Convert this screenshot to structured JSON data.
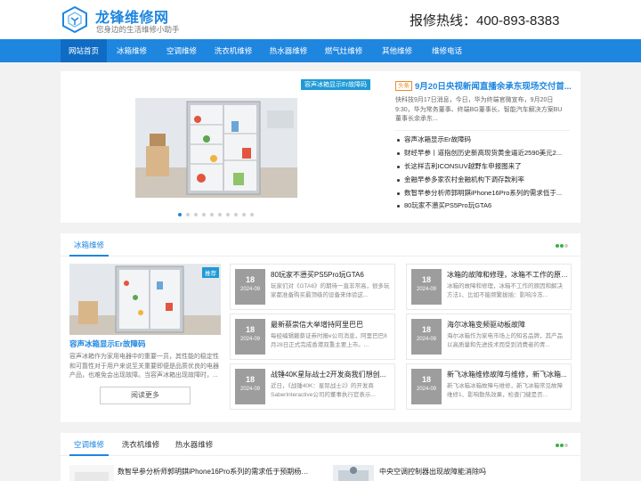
{
  "header": {
    "site_name": "龙锋维修网",
    "tagline": "您身边的生活维修小助手",
    "hotline": "报修热线：400-893-8383"
  },
  "nav": {
    "items": [
      {
        "label": "网站首页",
        "active": true
      },
      {
        "label": "冰箱维修"
      },
      {
        "label": "空调维修"
      },
      {
        "label": "洗衣机维修"
      },
      {
        "label": "热水器维修"
      },
      {
        "label": "燃气灶维修"
      },
      {
        "label": "其他维修"
      },
      {
        "label": "维修电话"
      }
    ]
  },
  "carousel": {
    "caption": "容声冰箱显示Er故障码",
    "dots_total": 10,
    "active_dot": 0
  },
  "headline": {
    "tag": "头条",
    "title": "9月20日央视新闻直播余承东现场交付首...",
    "desc": "快科技9月17日消息，今日，华为终端官微宣布，9月20日9:30，华为常务董事、终端BG董事长、智能汽车解决方案BU董事长余承东..."
  },
  "news_list": [
    "容声冰箱显示Er故障码",
    "财经早参丨道指创历史新高现货黄金逼近2590美元2...",
    "长这样吉利ICONSUV越野车申报图来了",
    "金融早参多家农村金融机构下调存款利率",
    "数智早参分析师郭明錤iPhone16Pro系列的需求低于...",
    "80玩家不懑买PS5Pro玩GTA6"
  ],
  "section1": {
    "tabs": [
      "冰箱维修"
    ],
    "featured": {
      "badge": "推荐",
      "title": "容声冰箱显示Er故障码",
      "desc": "容声冰箱作为家用电器中的重要一员，其性能的稳定性和可靠性对于用户来说至关重要即便是品质优良的电器产品，也难免会出现故障。当容声冰箱出现故障时，...",
      "more": "阅读更多"
    },
    "cards": [
      {
        "day": "18",
        "month": "2024-09",
        "title": "80玩家不懑买PS5Pro玩GTA6",
        "desc": "玩家们对《GTA6》的期待一直非常高，很多玩家都准备购买最顶级的设备来体验这..."
      },
      {
        "day": "18",
        "month": "2024-09",
        "title": "冰箱的故障和修理，冰箱不工作的原因和...",
        "desc": "冰箱的故障和修理，冰箱不工作的原因和解决方法1、比如不能频繁拔插：影响冷冻..."
      },
      {
        "day": "18",
        "month": "2024-09",
        "title": "最新蔡崇信大举增持阿里巴巴",
        "desc": "每经编辑戴蔡证券时报e公司消息，阿里巴巴8月28日正式完成香港双重主要上市。..."
      },
      {
        "day": "18",
        "month": "2024-09",
        "title": "海尔冰箱变频驱动板故障",
        "desc": "海尔冰箱作为家电市场上的知名品牌，其产品以高质量和先进技术而受到消费者的青..."
      },
      {
        "day": "18",
        "month": "2024-09",
        "title": "战锤40K星际战士2开发商我们想创...",
        "desc": "近日，《战锤40K：星际战士2》的开发商SaberInteractive公司的董事执行官表示..."
      },
      {
        "day": "18",
        "month": "2024-09",
        "title": "新飞冰箱维修故障与维修，新飞冰箱...",
        "desc": "新飞冰箱冰箱故障与维修，新飞冰箱常见故障维修1、影响散热效果，检查门缝是否..."
      }
    ]
  },
  "section2": {
    "tabs": [
      "空调维修",
      "洗衣机维修",
      "热水器维修"
    ],
    "items": [
      {
        "title": "数智早参分析师郭明錤iPhone16Pro系列的需求低于预期杨植麟..."
      },
      {
        "title": "中央空调控制器出现故障能消除吗"
      }
    ]
  },
  "colors": {
    "brand_blue": "#1f86e0",
    "nav_active": "#0f6cc4",
    "tag_orange": "#f08a2c",
    "green_dot": "#35b34a",
    "date_gray": "#9d9d9d"
  }
}
